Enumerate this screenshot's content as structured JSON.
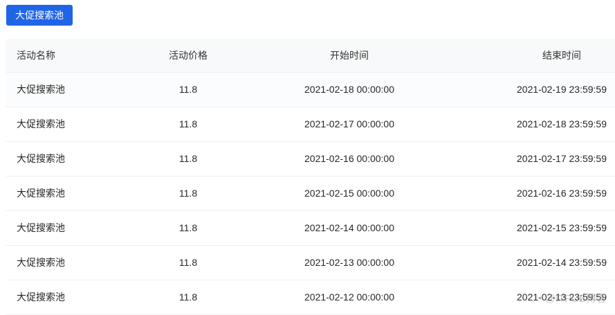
{
  "button": {
    "label": "大促搜索池"
  },
  "table": {
    "headers": [
      "活动名称",
      "活动价格",
      "开始时间",
      "结束时间"
    ],
    "rows": [
      [
        "大促搜索池",
        "11.8",
        "2021-02-18 00:00:00",
        "2021-02-19 23:59:59"
      ],
      [
        "大促搜索池",
        "11.8",
        "2021-02-17 00:00:00",
        "2021-02-18 23:59:59"
      ],
      [
        "大促搜索池",
        "11.8",
        "2021-02-16 00:00:00",
        "2021-02-17 23:59:59"
      ],
      [
        "大促搜索池",
        "11.8",
        "2021-02-15 00:00:00",
        "2021-02-16 23:59:59"
      ],
      [
        "大促搜索池",
        "11.8",
        "2021-02-14 00:00:00",
        "2021-02-15 23:59:59"
      ],
      [
        "大促搜索池",
        "11.8",
        "2021-02-13 00:00:00",
        "2021-02-14 23:59:59"
      ],
      [
        "大促搜索池",
        "11.8",
        "2021-02-12 00:00:00",
        "2021-02-13 23:59:59"
      ]
    ]
  },
  "watermark": "@ITPUB博客"
}
